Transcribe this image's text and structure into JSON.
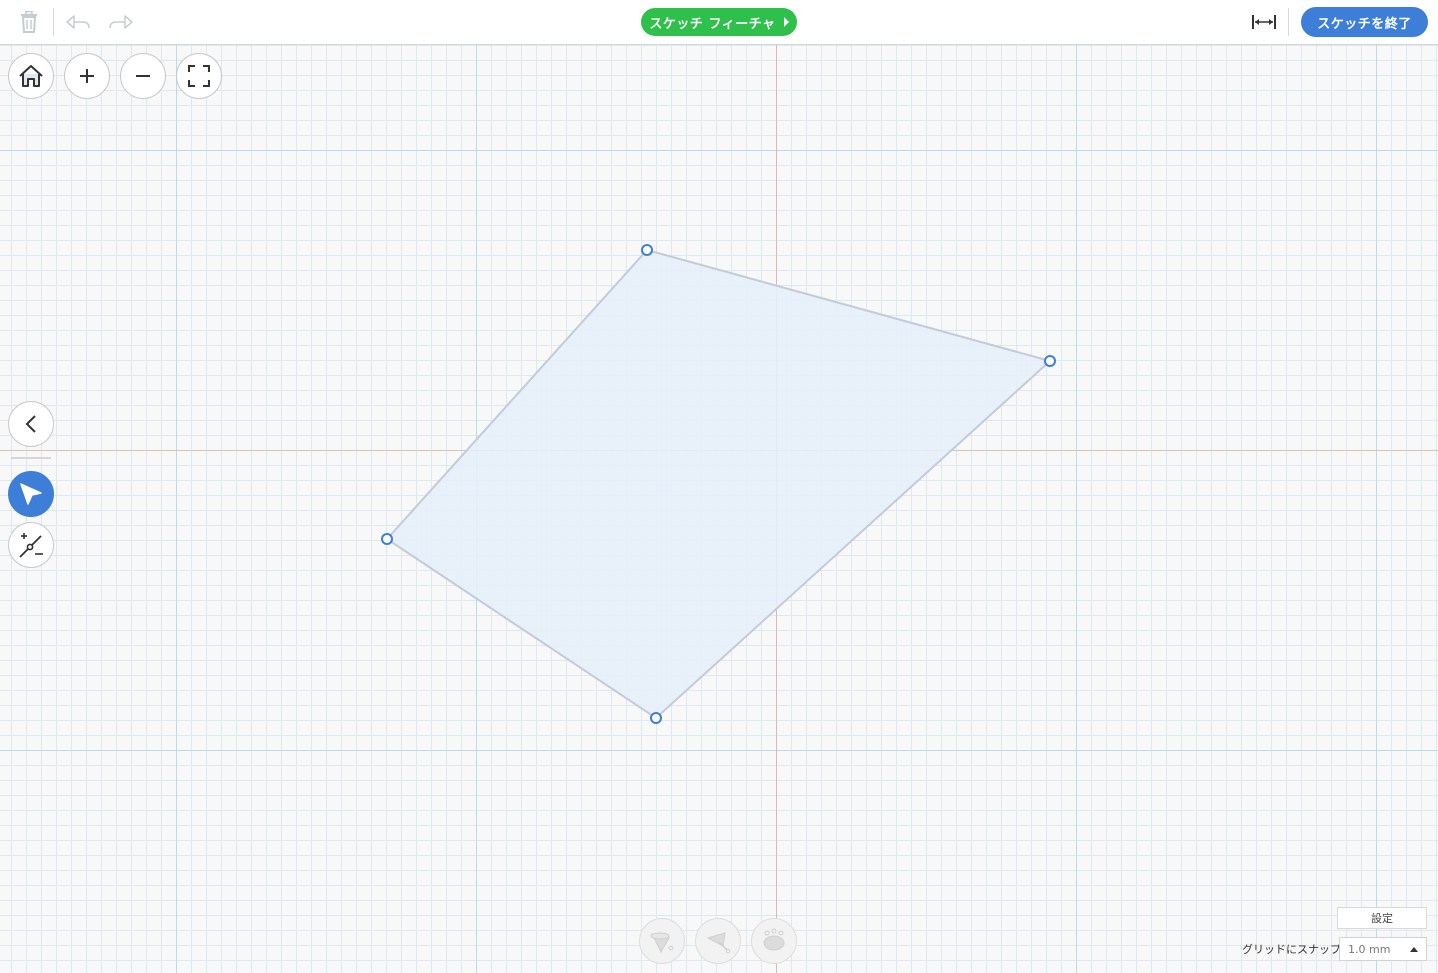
{
  "toolbar": {
    "delete_icon": "trash-icon",
    "undo_icon": "undo-icon",
    "redo_icon": "redo-icon",
    "sketch_feature_label": "スケッチ フィーチャ",
    "dimension_icon": "horizontal-dimension-icon",
    "finish_sketch_label": "スケッチを終了",
    "colors": {
      "green": "#2ec04a",
      "blue": "#3c7ed8"
    }
  },
  "view_controls": {
    "home_icon": "home-icon",
    "zoom_in_icon": "plus-icon",
    "zoom_out_icon": "minus-icon",
    "fit_icon": "fit-screen-icon"
  },
  "tools": {
    "collapse_icon": "chevron-left-icon",
    "select_icon": "pointer-arrow-icon",
    "add_remove_point_icon": "add-remove-point-icon"
  },
  "sketch": {
    "fill": "#e6eef9",
    "stroke": "#c3cbd9",
    "point_color": "#3c7ed8",
    "points": 4
  },
  "bottom_tools": {
    "icons": [
      "feature-cone-icon",
      "feature-tilt-icon",
      "feature-organic-icon"
    ]
  },
  "footer": {
    "settings_label": "設定",
    "snap_label": "グリッドにスナップ",
    "snap_value": "1.0 mm"
  }
}
